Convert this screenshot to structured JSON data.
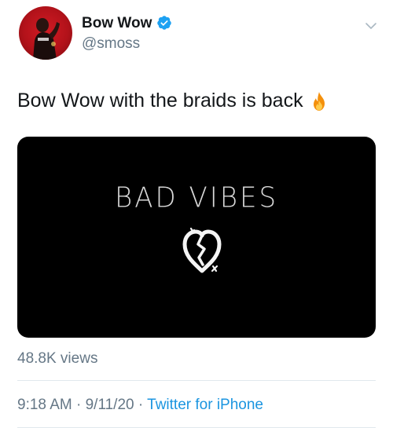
{
  "tweet": {
    "display_name": "Bow Wow",
    "handle": "@smoss",
    "text": "Bow Wow with the braids is back",
    "emoji_icon": "fire-icon",
    "media": {
      "title": "BAD VIBES",
      "icon": "broken-heart-icon"
    },
    "views": "48.8K views",
    "time": "9:18 AM",
    "date": "9/11/20",
    "separator": "·",
    "source": "Twitter for iPhone"
  },
  "colors": {
    "text": "#14171a",
    "secondary": "#657786",
    "link": "#1b95e0",
    "verified": "#1da1f2",
    "avatar_bg": "#c4151d",
    "media_bg": "#000000"
  }
}
